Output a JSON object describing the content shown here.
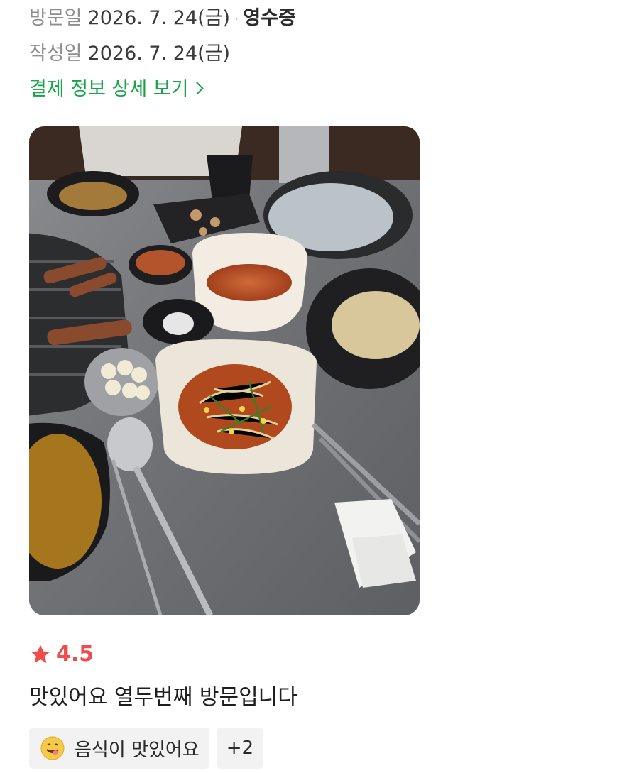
{
  "visit": {
    "label": "방문일",
    "date": "2026. 7. 24(금)",
    "separator": "·",
    "receipt_label": "영수증"
  },
  "written": {
    "label": "작성일",
    "date": "2026. 7. 24(금)"
  },
  "payment_link": {
    "label": "결제 정보 상세 보기"
  },
  "photo": {
    "description": "food-photo"
  },
  "rating": {
    "value": "4.5",
    "star_color": "#ef4c4c"
  },
  "review": {
    "text": "맛있어요 열두번째 방문입니다"
  },
  "tags": {
    "items": [
      {
        "label": "음식이 맛있어요",
        "icon": "yum-face-icon"
      }
    ],
    "more": "+2"
  },
  "colors": {
    "accent": "#16a34a",
    "rating": "#ef4c4c"
  }
}
